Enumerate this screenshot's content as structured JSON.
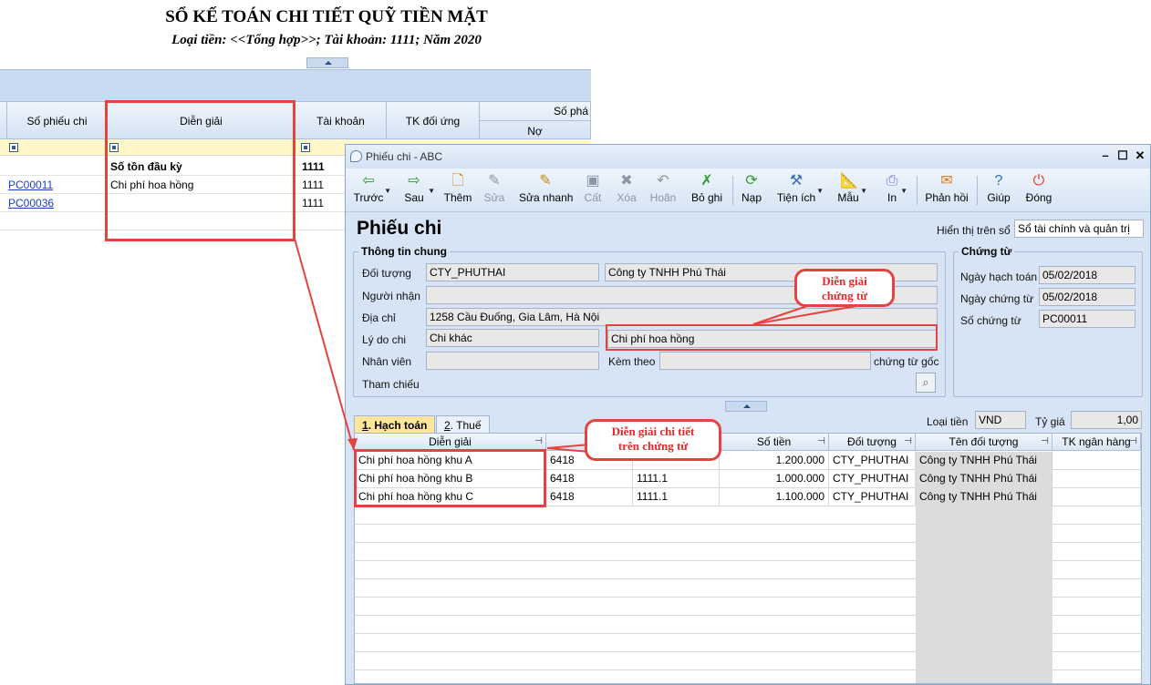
{
  "report": {
    "title": "SỔ KẾ TOÁN CHI TIẾT QUỸ TIỀN MẶT",
    "subtitle": "Loại tiền: <<Tổng hợp>>; Tài khoản: 1111; Năm 2020",
    "columns": {
      "so_phieu_chi": "Số phiếu chi",
      "dien_giai": "Diễn giải",
      "tai_khoan": "Tài khoản",
      "tk_doi_ung": "TK đối ứng",
      "so_phat_sinh": "Số phá",
      "no": "Nợ"
    },
    "rows": [
      {
        "so": "",
        "dien_giai": "Số tồn đầu kỳ",
        "tk": "1111"
      },
      {
        "so": "PC00011",
        "dien_giai": "Chi phí hoa hồng",
        "tk": "1111"
      },
      {
        "so": "PC00036",
        "dien_giai": "",
        "tk": "1111"
      }
    ]
  },
  "dialog": {
    "window_title": "Phiếu chi - ABC",
    "toolbar": {
      "truoc": "Trước",
      "sau": "Sau",
      "them": "Thêm",
      "sua": "Sửa",
      "sua_nhanh": "Sửa nhanh",
      "cat": "Cất",
      "xoa": "Xóa",
      "hoan": "Hoãn",
      "bo_ghi": "Bỏ ghi",
      "nap": "Nạp",
      "tien_ich": "Tiện ích",
      "mau": "Mẫu",
      "in": "In",
      "phan_hoi": "Phản hồi",
      "giup": "Giúp",
      "dong": "Đóng"
    },
    "heading": "Phiếu chi",
    "hien_thi_label": "Hiển thị trên sổ",
    "hien_thi_value": "Sổ tài chính và quản trị",
    "thong_tin_chung": {
      "title": "Thông tin chung",
      "doi_tuong_label": "Đối tượng",
      "doi_tuong_code": "CTY_PHUTHAI",
      "doi_tuong_name": "Công ty TNHH Phú Thái",
      "nguoi_nhan_label": "Người nhận",
      "nguoi_nhan": "",
      "dia_chi_label": "Địa chỉ",
      "dia_chi": "1258 Cầu Đuống, Gia Lâm, Hà Nội",
      "ly_do_chi_label": "Lý do chi",
      "ly_do_chi": "Chi khác",
      "dien_giai": "Chi phí hoa hồng",
      "nhan_vien_label": "Nhân viên",
      "nhan_vien": "",
      "kem_theo_label": "Kèm theo",
      "kem_theo": "",
      "chung_tu_goc": "chứng từ gốc",
      "tham_chieu_label": "Tham chiếu"
    },
    "chung_tu": {
      "title": "Chứng từ",
      "ngay_hach_toan_label": "Ngày hạch toán",
      "ngay_hach_toan": "05/02/2018",
      "ngay_chung_tu_label": "Ngày chứng từ",
      "ngay_chung_tu": "05/02/2018",
      "so_chung_tu_label": "Số chứng từ",
      "so_chung_tu": "PC00011"
    },
    "tabs": {
      "hach_toan_num": "1",
      "hach_toan": ". Hạch toán",
      "thue_num": "2",
      "thue": ". Thuế"
    },
    "loai_tien_label": "Loại tiền",
    "loai_tien": "VND",
    "ty_gia_label": "Tỷ giá",
    "ty_gia": "1,00",
    "grid": {
      "columns": {
        "dien_giai": "Diễn giải",
        "so_tien": "Số tiền",
        "doi_tuong": "Đối tượng",
        "ten_doi_tuong": "Tên đối tượng",
        "tk_ngan_hang": "TK ngân hàng"
      },
      "rows": [
        {
          "dien_giai": "Chi phí hoa hồng khu A",
          "tk_no": "6418",
          "tk_co": "",
          "so_tien": "1.200.000",
          "doi_tuong": "CTY_PHUTHAI",
          "ten_doi_tuong": "Công ty TNHH Phú Thái"
        },
        {
          "dien_giai": "Chi phí hoa hồng khu B",
          "tk_no": "6418",
          "tk_co": "1111.1",
          "so_tien": "1.000.000",
          "doi_tuong": "CTY_PHUTHAI",
          "ten_doi_tuong": "Công ty TNHH Phú Thái"
        },
        {
          "dien_giai": "Chi phí hoa hồng khu C",
          "tk_no": "6418",
          "tk_co": "1111.1",
          "so_tien": "1.100.000",
          "doi_tuong": "CTY_PHUTHAI",
          "ten_doi_tuong": "Công ty TNHH Phú Thái"
        }
      ]
    }
  },
  "callouts": {
    "chung_tu_line1": "Diễn giải",
    "chung_tu_line2": "chứng từ",
    "chi_tiet_line1": "Diễn giải chi tiết",
    "chi_tiet_line2": "trên chứng từ"
  },
  "colors": {
    "accent_red": "#e5433f",
    "panel_blue": "#d6e4f5",
    "active_tab": "#ffe69a"
  }
}
